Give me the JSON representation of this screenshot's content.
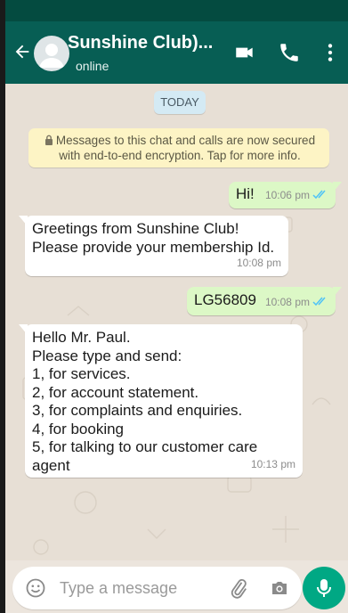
{
  "header": {
    "title": "Sunshine Club)...",
    "subtitle": "online",
    "icons": [
      "back-arrow-icon",
      "avatar",
      "video-call-icon",
      "phone-icon",
      "more-vert-icon"
    ]
  },
  "chat": {
    "date_label": "TODAY",
    "system_message": "Messages to this chat and calls are now secured with end-to-end encryption. Tap for more info.",
    "messages": [
      {
        "direction": "outgoing",
        "text": "Hi!",
        "time": "10:06 pm",
        "status": "read"
      },
      {
        "direction": "incoming",
        "text": "Greetings from Sunshine Club!\nPlease provide your membership Id.",
        "time": "10:08 pm"
      },
      {
        "direction": "outgoing",
        "text": "LG56809",
        "time": "10:08 pm",
        "status": "read"
      },
      {
        "direction": "incoming",
        "text": "Hello Mr. Paul.\nPlease type and send:\n1, for services.\n2, for account statement.\n3, for complaints and enquiries.\n4, for booking\n5, for talking to our customer care agent",
        "time": "10:13 pm"
      }
    ]
  },
  "composer": {
    "placeholder": "Type a message",
    "icons": [
      "emoji-icon",
      "attach-icon",
      "camera-icon",
      "mic-icon"
    ]
  },
  "colors": {
    "header": "#075e54",
    "outgoing_bubble": "#dcf8c6",
    "incoming_bubble": "#ffffff",
    "read_ticks": "#4fc3f7",
    "mic_button": "#00a884"
  }
}
